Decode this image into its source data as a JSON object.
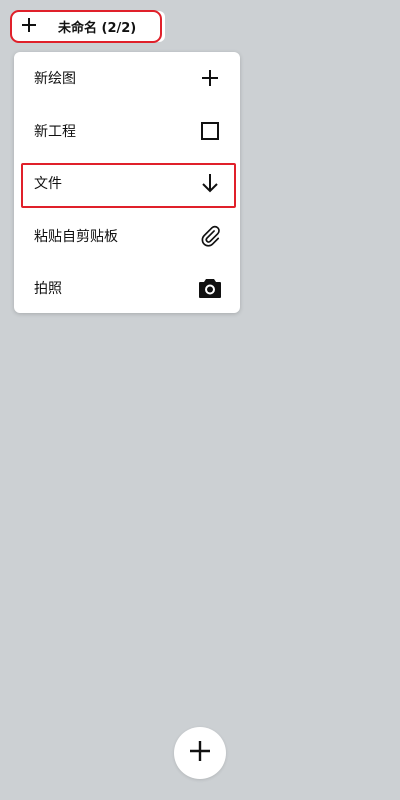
{
  "tabbar": {
    "title": "未命名 (2/2)",
    "add_icon": "plus-icon"
  },
  "menu": {
    "items": [
      {
        "label": "新绘图",
        "icon": "plus-icon"
      },
      {
        "label": "新工程",
        "icon": "square-icon"
      },
      {
        "label": "文件",
        "icon": "arrow-down-icon"
      },
      {
        "label": "粘贴自剪贴板",
        "icon": "paperclip-icon"
      },
      {
        "label": "拍照",
        "icon": "camera-icon"
      }
    ]
  },
  "fab": {
    "icon": "plus-icon"
  },
  "colors": {
    "background": "#ccd0d3",
    "surface": "#ffffff",
    "highlight": "#e0202a"
  }
}
